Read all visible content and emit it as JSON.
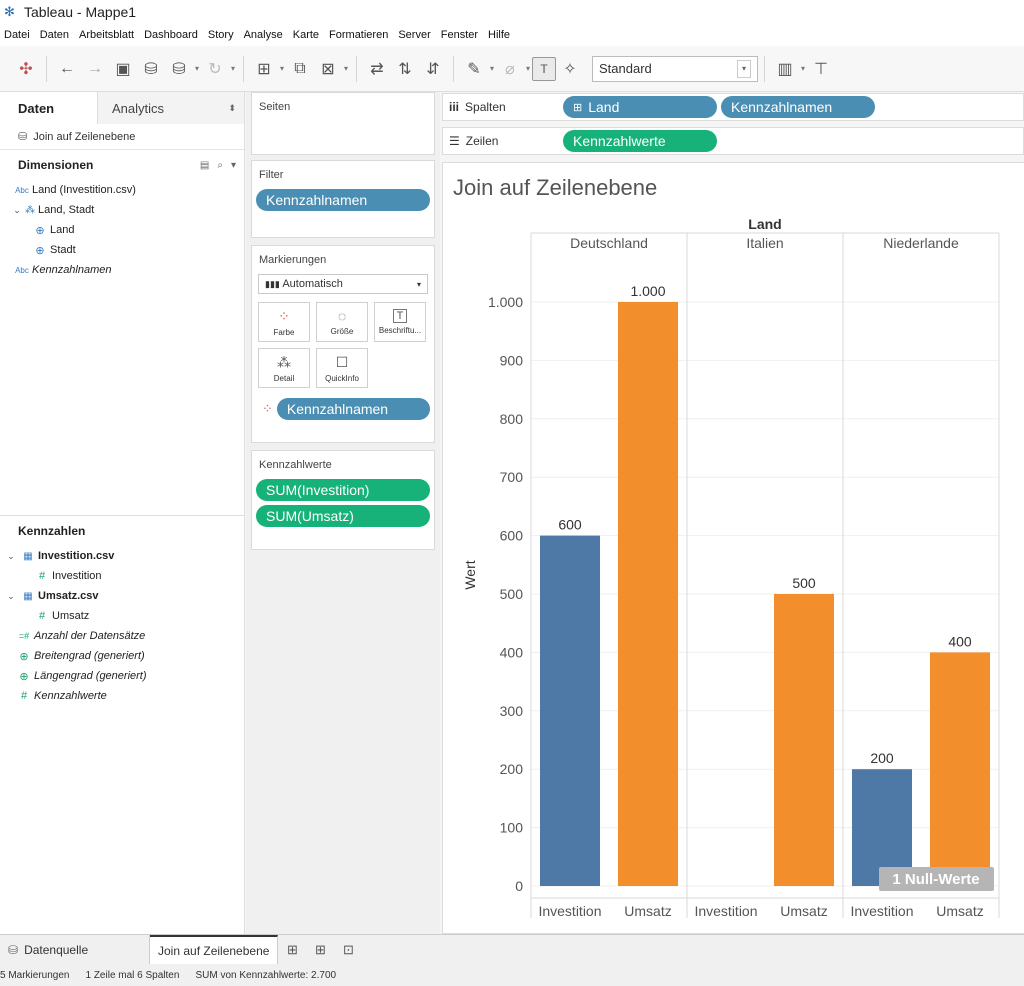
{
  "window": {
    "title": "Tableau - Mappe1"
  },
  "menu": [
    "Datei",
    "Daten",
    "Arbeitsblatt",
    "Dashboard",
    "Story",
    "Analyse",
    "Karte",
    "Formatieren",
    "Server",
    "Fenster",
    "Hilfe"
  ],
  "toolbar": {
    "view_mode": "Standard"
  },
  "data_pane": {
    "tab_data": "Daten",
    "tab_analytics": "Analytics",
    "source": "Join auf Zeilenebene",
    "dimensions_header": "Dimensionen",
    "dimensions": [
      {
        "type": "Abc",
        "label": "Land (Investition.csv)",
        "italic": false,
        "indent": 0
      },
      {
        "type": "hier",
        "label": "Land, Stadt",
        "italic": false,
        "indent": 0
      },
      {
        "type": "geo",
        "label": "Land",
        "italic": false,
        "indent": 1
      },
      {
        "type": "geo",
        "label": "Stadt",
        "italic": false,
        "indent": 1
      },
      {
        "type": "Abc",
        "label": "Kennzahlnamen",
        "italic": true,
        "indent": 0
      }
    ],
    "measures_header": "Kennzahlen",
    "measures": [
      {
        "type": "table",
        "label": "Investition.csv",
        "bold": true,
        "italic": false,
        "indent": 0
      },
      {
        "type": "#",
        "label": "Investition",
        "bold": false,
        "italic": false,
        "indent": 1
      },
      {
        "type": "table",
        "label": "Umsatz.csv",
        "bold": true,
        "italic": false,
        "indent": 0
      },
      {
        "type": "#",
        "label": "Umsatz",
        "bold": false,
        "italic": false,
        "indent": 1
      },
      {
        "type": "=#",
        "label": "Anzahl der Datensätze",
        "bold": false,
        "italic": true,
        "indent": 0
      },
      {
        "type": "geo",
        "label": "Breitengrad (generiert)",
        "bold": false,
        "italic": true,
        "indent": 0
      },
      {
        "type": "geo",
        "label": "Längengrad (generiert)",
        "bold": false,
        "italic": true,
        "indent": 0
      },
      {
        "type": "#",
        "label": "Kennzahlwerte",
        "bold": false,
        "italic": true,
        "indent": 0
      }
    ]
  },
  "cards": {
    "pages": "Seiten",
    "filter": "Filter",
    "filter_pill": "Kennzahlnamen",
    "marks": "Markierungen",
    "marks_type": "Automatisch",
    "marks_buttons": [
      "Farbe",
      "Größe",
      "Beschriftu...",
      "Detail",
      "QuickInfo"
    ],
    "marks_pill": "Kennzahlnamen",
    "measure_values": "Kennzahlwerte",
    "measure_pills": [
      "SUM(Investition)",
      "SUM(Umsatz)"
    ]
  },
  "shelves": {
    "columns_label": "Spalten",
    "columns_pills": [
      "Land",
      "Kennzahlnamen"
    ],
    "rows_label": "Zeilen",
    "rows_pills": [
      "Kennzahlwerte"
    ]
  },
  "chart_data": {
    "type": "bar",
    "title": "Join auf Zeilenebene",
    "column_header": "Land",
    "groups": [
      "Deutschland",
      "Italien",
      "Niederlande"
    ],
    "categories": [
      "Investition",
      "Umsatz"
    ],
    "series": [
      {
        "name": "Investition",
        "color": "#4e79a7",
        "values": [
          600,
          null,
          200
        ]
      },
      {
        "name": "Umsatz",
        "color": "#f28e2b",
        "values": [
          1000,
          500,
          400
        ]
      }
    ],
    "value_labels": [
      [
        "600",
        "1.000"
      ],
      [
        "",
        "500"
      ],
      [
        "200",
        "400"
      ]
    ],
    "ylabel": "Wert",
    "ylim": [
      0,
      1000
    ],
    "y_ticks": [
      "0",
      "100",
      "200",
      "300",
      "400",
      "500",
      "600",
      "700",
      "800",
      "900",
      "1.000"
    ],
    "null_indicator": "1 Null-Werte"
  },
  "sheet_tabs": {
    "datasource": "Datenquelle",
    "active": "Join auf Zeilenebene"
  },
  "status": {
    "marks": "5 Markierungen",
    "rows": "1 Zeile mal 6 Spalten",
    "sum": "SUM von Kennzahlwerte: 2.700"
  }
}
